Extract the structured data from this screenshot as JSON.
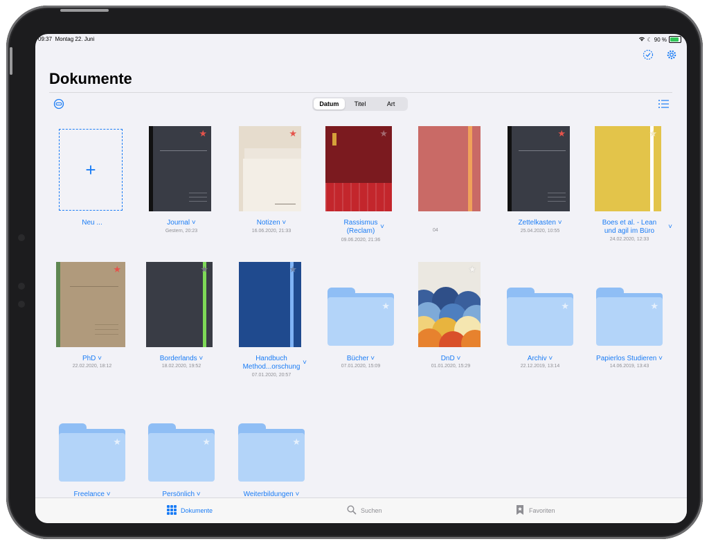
{
  "status": {
    "time": "09:37",
    "date": "Montag 22. Juni",
    "battery": "90 %"
  },
  "page": {
    "title": "Dokumente"
  },
  "sort": {
    "options": [
      "Datum",
      "Titel",
      "Art"
    ],
    "selected": "Datum"
  },
  "new_item": {
    "label": "Neu ..."
  },
  "items": [
    {
      "name": "Journal ˅",
      "date": "Gestern, 20:23"
    },
    {
      "name": "Notizen ˅",
      "date": "16.06.2020, 21:33"
    },
    {
      "name": "Rassismus",
      "name2": "(Reclam)",
      "date": "09.06.2020, 21:36"
    },
    {
      "name": "",
      "date": "04"
    },
    {
      "name": "Zettelkasten ˅",
      "date": "25.04.2020, 10:55"
    },
    {
      "name": "Boes et al. - Lean",
      "name2": "und agil im Büro",
      "date": "24.02.2020, 12:33"
    },
    {
      "name": "PhD ˅",
      "date": "22.02.2020, 18:12"
    },
    {
      "name": "Borderlands ˅",
      "date": "18.02.2020, 19:52"
    },
    {
      "name": "Handbuch",
      "name2": "Method...orschung",
      "date": "07.01.2020, 20:57"
    },
    {
      "name": "Bücher ˅",
      "date": "07.01.2020, 15:09"
    },
    {
      "name": "DnD ˅",
      "date": "01.01.2020, 15:29"
    },
    {
      "name": "Archiv ˅",
      "date": "22.12.2019, 13:14"
    },
    {
      "name": "Papierlos Studieren ˅",
      "date": "14.06.2019, 13:43"
    },
    {
      "name": "Freelance ˅",
      "date": ""
    },
    {
      "name": "Persönlich ˅",
      "date": ""
    },
    {
      "name": "Weiterbildungen ˅",
      "date": ""
    }
  ],
  "chevron": "˅",
  "tabs": {
    "documents": "Dokumente",
    "search": "Suchen",
    "favorites": "Favoriten"
  },
  "colors": {
    "accent": "#1a7cf5",
    "star_fav": "#e5534b",
    "folder": "#b3d4f9",
    "folder_tab": "#8fbef5"
  }
}
